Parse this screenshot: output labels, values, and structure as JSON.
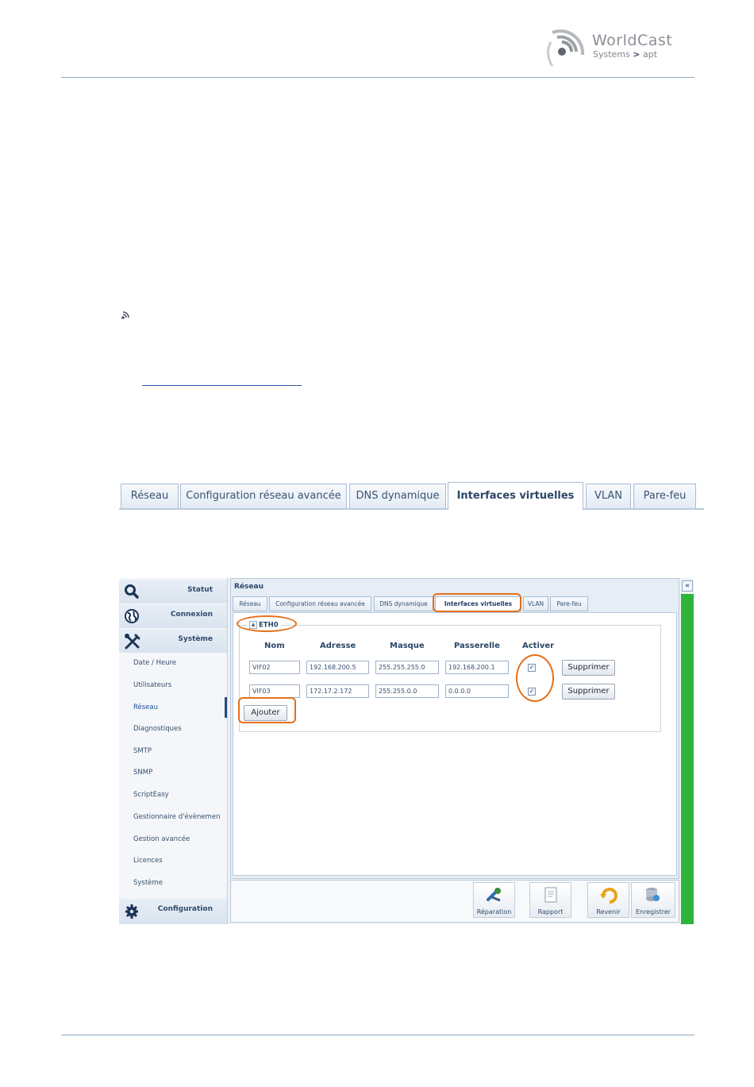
{
  "header": {
    "brand_name": "WorldCast",
    "brand_sub": "Systems",
    "brand_sub_arrow": ">",
    "brand_sub_apt": "apt"
  },
  "big_tabs": [
    {
      "label": "Réseau"
    },
    {
      "label": "Configuration réseau avancée"
    },
    {
      "label": "DNS dynamique"
    },
    {
      "label": "Interfaces virtuelles"
    },
    {
      "label": "VLAN"
    },
    {
      "label": "Pare-feu"
    }
  ],
  "sidebar": {
    "main": [
      {
        "label": "Statut",
        "icon": "magnifier-icon"
      },
      {
        "label": "Connexion",
        "icon": "globe-icon"
      },
      {
        "label": "Système",
        "icon": "tools-icon"
      }
    ],
    "items": [
      {
        "label": "Date / Heure"
      },
      {
        "label": "Utilisateurs"
      },
      {
        "label": "Réseau"
      },
      {
        "label": "Diagnostiques"
      },
      {
        "label": "SMTP"
      },
      {
        "label": "SNMP"
      },
      {
        "label": "ScriptEasy"
      },
      {
        "label": "Gestionnaire d'évènemen"
      },
      {
        "label": "Gestion avancée"
      },
      {
        "label": "Licences"
      },
      {
        "label": "Système"
      }
    ],
    "footer": {
      "label": "Configuration",
      "icon": "gear-icon"
    }
  },
  "panel": {
    "title": "Réseau",
    "tabs": [
      {
        "label": "Réseau"
      },
      {
        "label": "Configuration réseau avancée"
      },
      {
        "label": "DNS dynamique"
      },
      {
        "label": "Interfaces virtuelles"
      },
      {
        "label": "VLAN"
      },
      {
        "label": "Pare-feu"
      }
    ],
    "legend": "ETH0",
    "legend_toggle": "▲",
    "columns": [
      "Nom",
      "Adresse",
      "Masque",
      "Passerelle",
      "Activer"
    ],
    "rows": [
      {
        "nom": "VIF02",
        "adresse": "192.168.200.5",
        "masque": "255.255.255.0",
        "passerelle": "192.168.200.1",
        "activer": "✓",
        "delete": "Supprimer"
      },
      {
        "nom": "VIF03",
        "adresse": "172.17.2.172",
        "masque": "255.255.0.0",
        "passerelle": "0.0.0.0",
        "activer": "✓",
        "delete": "Supprimer"
      }
    ],
    "add_label": "Ajouter"
  },
  "toolbar": [
    {
      "label": "Réparation",
      "icon": "repair-icon"
    },
    {
      "label": "Rapport",
      "icon": "report-icon"
    },
    {
      "label": "Revenir",
      "icon": "revert-icon"
    },
    {
      "label": "Enregistrer",
      "icon": "save-icon"
    }
  ],
  "collapse_label": "«",
  "colors": {
    "accent_orange": "#e46f1c",
    "status_green": "#2eb43a",
    "rule_blue": "#8fa9c6"
  }
}
